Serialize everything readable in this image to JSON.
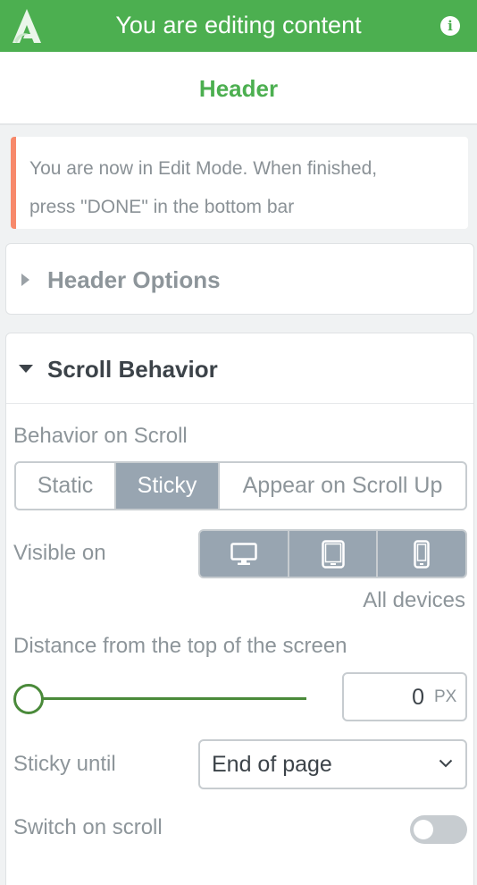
{
  "topbar": {
    "title": "You are editing content",
    "logo_icon": "a-logo-icon",
    "info_icon": "info-icon",
    "info_glyph": "i"
  },
  "panel": {
    "title": "Header"
  },
  "notice": {
    "line1": "You are now in Edit Mode. When finished,",
    "line2": "press \"DONE\" in the bottom bar"
  },
  "sections": [
    {
      "title": "Header Options",
      "expanded": false
    },
    {
      "title": "Scroll Behavior",
      "expanded": true
    }
  ],
  "scroll": {
    "behavior_label": "Behavior on Scroll",
    "behavior_options": [
      "Static",
      "Sticky",
      "Appear on Scroll Up"
    ],
    "behavior_selected": "Sticky",
    "visible_label": "Visible on",
    "devices": [
      "desktop-icon",
      "tablet-icon",
      "mobile-icon"
    ],
    "devices_caption": "All devices",
    "distance_label": "Distance from the top of the screen",
    "distance_value": "0",
    "distance_unit": "PX",
    "sticky_until_label": "Sticky until",
    "sticky_until_value": "End of page",
    "switch_label": "Switch on scroll",
    "switch_on": false
  },
  "colors": {
    "brand": "#4caf50",
    "selected_segment": "#98a5b1",
    "notice_accent": "#f7896b",
    "slider": "#4a8a3a"
  }
}
